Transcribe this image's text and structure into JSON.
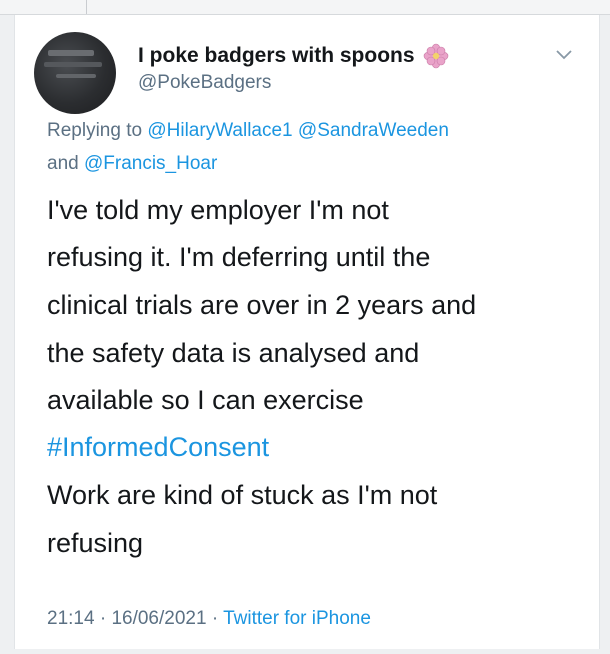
{
  "user": {
    "display_name": "I poke badgers with spoons",
    "handle": "@PokeBadgers",
    "badge_icon": "flower-icon",
    "avatar_icon": "avatar"
  },
  "reply": {
    "prefix": "Replying to",
    "mentions": [
      "@HilaryWallace1",
      "@SandraWeeden",
      "@Francis_Hoar"
    ],
    "joiner": "and"
  },
  "tweet": {
    "lines": [
      "I've told my employer I'm not",
      "refusing it. I'm deferring until the",
      "clinical trials are over in 2 years and",
      "the safety data is analysed and",
      "available so I can exercise"
    ],
    "hashtag": "#InformedConsent",
    "lines_after": [
      "Work are kind of stuck as I'm not",
      "refusing"
    ]
  },
  "meta": {
    "time": "21:14",
    "separator": "·",
    "date": "16/06/2021",
    "source": "Twitter for iPhone"
  },
  "colors": {
    "link": "#1b95e0",
    "secondary_text": "#5b7083",
    "primary_text": "#14171a",
    "flower": "#e9a3c9"
  },
  "menu_icon": "chevron-down-icon"
}
